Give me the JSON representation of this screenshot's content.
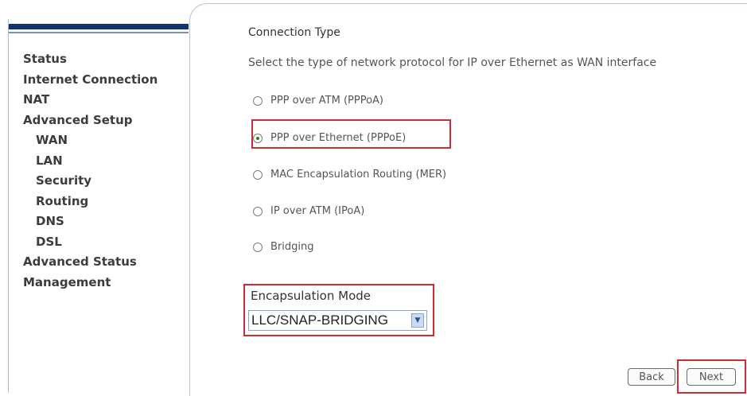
{
  "sidebar": {
    "items": [
      {
        "label": "Status",
        "sub": false
      },
      {
        "label": "Internet Connection",
        "sub": false
      },
      {
        "label": "NAT",
        "sub": false
      },
      {
        "label": "Advanced Setup",
        "sub": false
      },
      {
        "label": "WAN",
        "sub": true
      },
      {
        "label": "LAN",
        "sub": true
      },
      {
        "label": "Security",
        "sub": true
      },
      {
        "label": "Routing",
        "sub": true
      },
      {
        "label": "DNS",
        "sub": true
      },
      {
        "label": "DSL",
        "sub": true
      },
      {
        "label": "Advanced Status",
        "sub": false
      },
      {
        "label": "Management",
        "sub": false
      }
    ]
  },
  "main": {
    "title": "Connection Type",
    "description": "Select the type of network protocol for IP over Ethernet as WAN interface",
    "options": [
      {
        "label": "PPP over ATM (PPPoA)",
        "checked": false
      },
      {
        "label": "PPP over Ethernet (PPPoE)",
        "checked": true
      },
      {
        "label": "MAC Encapsulation Routing (MER)",
        "checked": false
      },
      {
        "label": "IP over ATM (IPoA)",
        "checked": false
      },
      {
        "label": "Bridging",
        "checked": false
      }
    ],
    "encapsulation": {
      "label": "Encapsulation Mode",
      "value": "LLC/SNAP-BRIDGING"
    },
    "buttons": {
      "back": "Back",
      "next": "Next"
    }
  },
  "colors": {
    "highlight": "#d02a34",
    "sidebar_bar": "#12346e"
  }
}
